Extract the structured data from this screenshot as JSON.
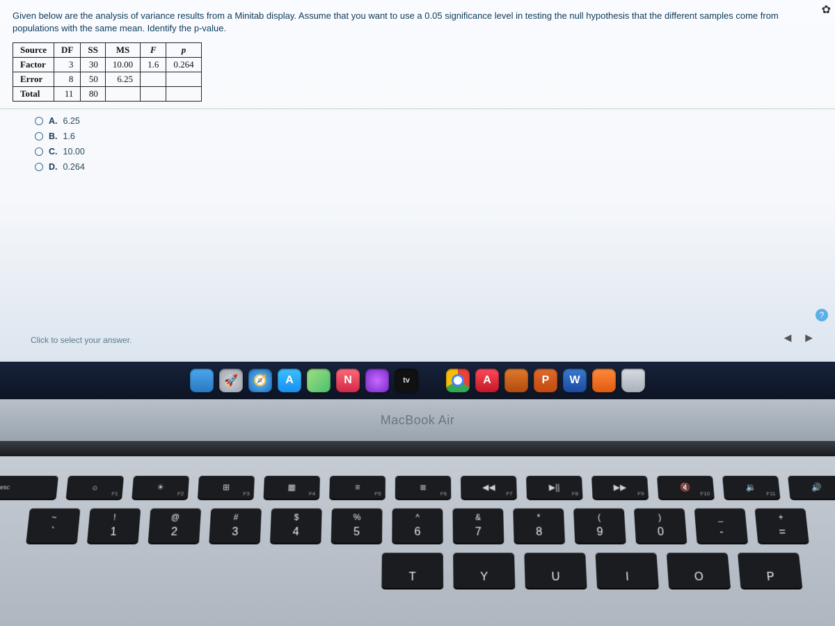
{
  "question": {
    "prompt": "Given below are the analysis of variance results from a Minitab display. Assume that you want to use a 0.05 significance level in testing the null hypothesis that the different samples come from populations with the same mean. Identify the p-value."
  },
  "anova": {
    "headers": [
      "Source",
      "DF",
      "SS",
      "MS",
      "F",
      "p"
    ],
    "rows": [
      {
        "source": "Factor",
        "df": "3",
        "ss": "30",
        "ms": "10.00",
        "f": "1.6",
        "p": "0.264"
      },
      {
        "source": "Error",
        "df": "8",
        "ss": "50",
        "ms": "6.25",
        "f": "",
        "p": ""
      },
      {
        "source": "Total",
        "df": "11",
        "ss": "80",
        "ms": "",
        "f": "",
        "p": ""
      }
    ]
  },
  "choices": [
    {
      "letter": "A.",
      "text": "6.25"
    },
    {
      "letter": "B.",
      "text": "1.6"
    },
    {
      "letter": "C.",
      "text": "10.00"
    },
    {
      "letter": "D.",
      "text": "0.264"
    }
  ],
  "hint": "Click to select your answer.",
  "dock": {
    "tv_label": "tv"
  },
  "laptop": {
    "model": "MacBook Air"
  },
  "keyboard": {
    "fn_row": [
      {
        "icon": "esc",
        "fn": ""
      },
      {
        "icon": "☼",
        "fn": "F1"
      },
      {
        "icon": "☀",
        "fn": "F2"
      },
      {
        "icon": "⊞",
        "fn": "F3"
      },
      {
        "icon": "▦",
        "fn": "F4"
      },
      {
        "icon": "≡",
        "fn": "F5"
      },
      {
        "icon": "≣",
        "fn": "F6"
      },
      {
        "icon": "◀◀",
        "fn": "F7"
      },
      {
        "icon": "▶||",
        "fn": "F8"
      },
      {
        "icon": "▶▶",
        "fn": "F9"
      },
      {
        "icon": "🔇",
        "fn": "F10"
      },
      {
        "icon": "🔉",
        "fn": "F11"
      },
      {
        "icon": "🔊",
        "fn": ""
      }
    ],
    "num_row": [
      {
        "top": "~",
        "bot": "`"
      },
      {
        "top": "!",
        "bot": "1"
      },
      {
        "top": "@",
        "bot": "2"
      },
      {
        "top": "#",
        "bot": "3"
      },
      {
        "top": "$",
        "bot": "4"
      },
      {
        "top": "%",
        "bot": "5"
      },
      {
        "top": "^",
        "bot": "6"
      },
      {
        "top": "&",
        "bot": "7"
      },
      {
        "top": "*",
        "bot": "8"
      },
      {
        "top": "(",
        "bot": "9"
      },
      {
        "top": ")",
        "bot": "0"
      },
      {
        "top": "_",
        "bot": "-"
      },
      {
        "top": "+",
        "bot": "="
      }
    ],
    "letter_row": [
      "T",
      "Y",
      "U",
      "I",
      "O",
      "P"
    ]
  }
}
